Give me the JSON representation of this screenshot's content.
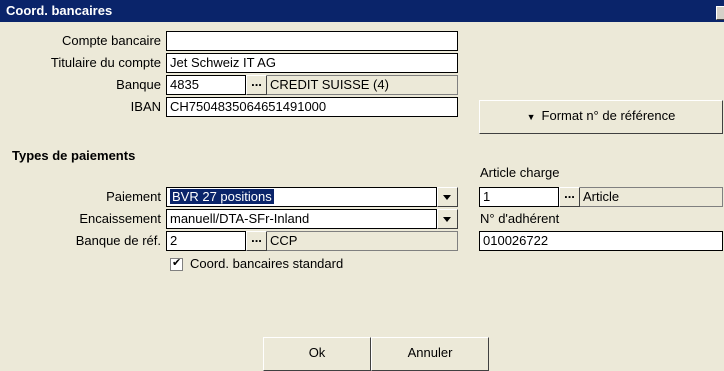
{
  "window": {
    "title": "Coord. bancaires"
  },
  "account": {
    "compte_label": "Compte bancaire",
    "compte_value": "",
    "titulaire_label": "Titulaire du compte",
    "titulaire_value": "Jet Schweiz IT AG",
    "banque_label": "Banque",
    "banque_code": "4835",
    "banque_name": "CREDIT SUISSE (4)",
    "iban_label": "IBAN",
    "iban_value": "CH7504835064651491000",
    "format_button": "Format n° de référence",
    "browse": "..."
  },
  "payments": {
    "section_title": "Types de paiements",
    "paiement_label": "Paiement",
    "paiement_value": "BVR 27 positions",
    "encaissement_label": "Encaissement",
    "encaissement_value": "manuell/DTA-SFr-Inland",
    "banque_ref_label": "Banque de réf.",
    "banque_ref_code": "2",
    "banque_ref_name": "CCP",
    "article_label": "Article charge",
    "article_code": "1",
    "article_name": "Article",
    "adherent_label": "N° d'adhérent",
    "adherent_value": "010026722",
    "standard_checkbox_label": "Coord. bancaires standard",
    "standard_checked": true
  },
  "buttons": {
    "ok": "Ok",
    "cancel": "Annuler"
  }
}
